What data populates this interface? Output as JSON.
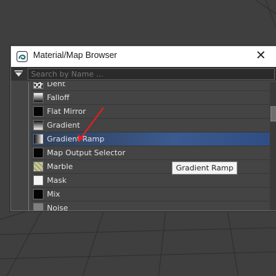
{
  "window": {
    "title": "Material/Map Browser",
    "close_glyph": "✕",
    "icon": "3dsmax-logo-icon"
  },
  "search": {
    "placeholder": "Search by Name ..."
  },
  "list": {
    "items": [
      {
        "label": "Dent",
        "thumb": "dent"
      },
      {
        "label": "Falloff",
        "thumb": "falloff"
      },
      {
        "label": "Flat Mirror",
        "thumb": "flat-mirror"
      },
      {
        "label": "Gradient",
        "thumb": "gradient"
      },
      {
        "label": "Gradient Ramp",
        "thumb": "gradient-ramp",
        "selected": true
      },
      {
        "label": "Map Output Selector",
        "thumb": "map-output"
      },
      {
        "label": "Marble",
        "thumb": "marble"
      },
      {
        "label": "Mask",
        "thumb": "mask"
      },
      {
        "label": "Mix",
        "thumb": "mix"
      },
      {
        "label": "Noise",
        "thumb": "noise"
      }
    ]
  },
  "tooltip": {
    "text": "Gradient Ramp"
  },
  "colors": {
    "selection": "#3b5a8f",
    "annotation": "#e02020"
  }
}
